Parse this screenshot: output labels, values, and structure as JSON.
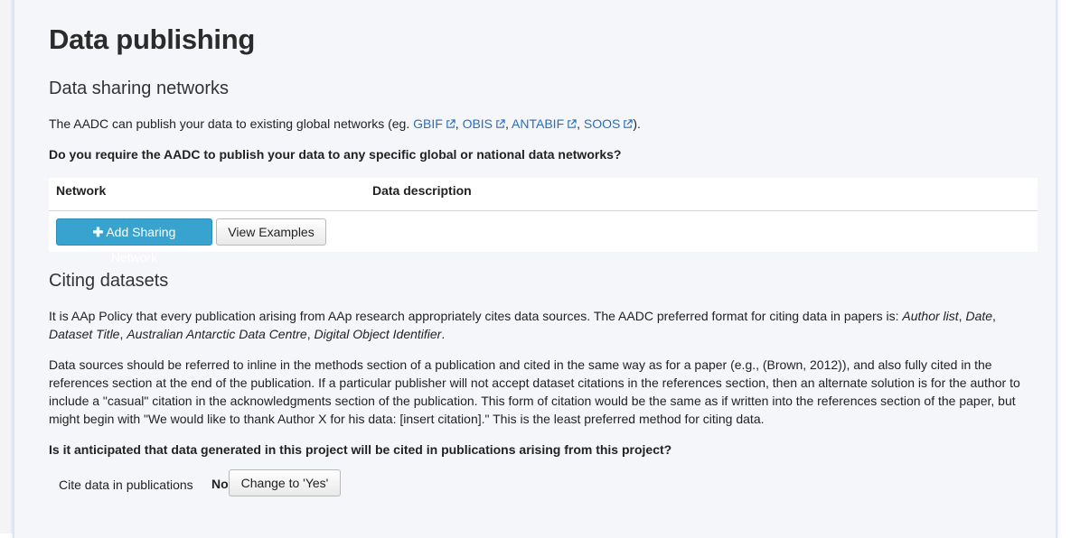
{
  "page": {
    "title": "Data publishing"
  },
  "sharing": {
    "heading": "Data sharing networks",
    "intro_prefix": "The AADC can publish your data to existing global networks (eg. ",
    "networks": [
      {
        "label": "GBIF",
        "icon": "external-link-icon"
      },
      {
        "label": "OBIS",
        "icon": "external-link-icon"
      },
      {
        "label": "ANTABIF",
        "icon": "external-link-icon"
      },
      {
        "label": "SOOS",
        "icon": "external-link-icon"
      }
    ],
    "sep": ", ",
    "intro_suffix": ").",
    "question": "Do you require the AADC to publish your data to any specific global or national data networks?",
    "table": {
      "col_network": "Network",
      "col_description": "Data description"
    },
    "add_button": "Add Sharing Network",
    "add_icon": "plus-icon",
    "examples_button": "View Examples"
  },
  "citing": {
    "heading": "Citing datasets",
    "p1_text": "It is AAp Policy that every publication arising from AAp research appropriately cites data sources. The AADC preferred format for citing data in papers is: ",
    "p1_italic_1": "Author list",
    "p1_comma": ", ",
    "p1_italic_2": "Date",
    "p1_italic_3": "Dataset Title",
    "p1_italic_4": "Australian Antarctic Data Centre",
    "p1_italic_5": "Digital Object Identifier",
    "p1_end": ".",
    "p2_line1": "Data sources should be referred to inline in the methods section of a publication and cited in the same way as for a paper (e.g., (Brown, 2012)), and also fully cited in the",
    "p2_line2": "references section at the end of the publication. If a particular publisher will not accept dataset citations in the references section, then an alternate solution is for the author to",
    "p2_line3": "include a \"casual\" citation in the acknowledgments section of the publication. This form of citation would be the same as if written into the references section of the paper, but",
    "p2_line4": "might begin with \"We would like to thank Author X for his data: [insert citation].\" This is the least preferred method for citing data.",
    "question": "Is it anticipated that data generated in this project will be cited in publications arising from this project?",
    "field_label": "Cite data in publications",
    "field_value": "No",
    "change_button": "Change to 'Yes'"
  }
}
